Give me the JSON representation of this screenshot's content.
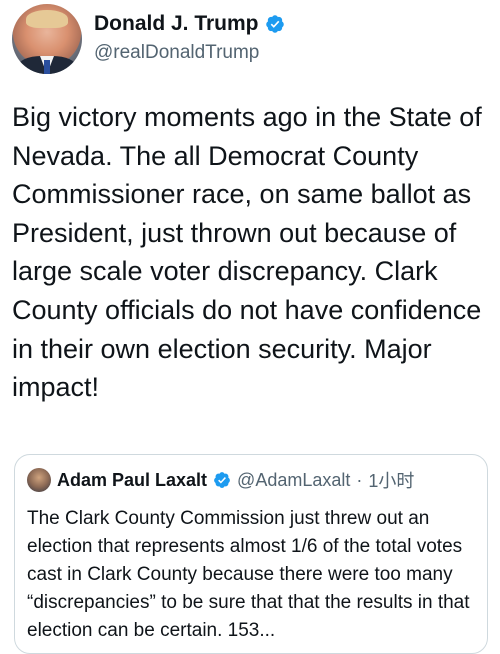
{
  "tweet": {
    "author": {
      "display_name": "Donald J. Trump",
      "handle": "@realDonaldTrump",
      "verified": true
    },
    "text": "Big victory moments ago in the State of Nevada. The all Democrat County Commissioner race, on same ballot as President, just thrown out because of large scale voter discrepancy. Clark County officials do not have confidence in their own election security. Major impact!"
  },
  "quoted_tweet": {
    "author": {
      "display_name": "Adam Paul Laxalt",
      "handle": "@AdamLaxalt",
      "verified": true
    },
    "separator": "·",
    "time": "1小时",
    "text": "The Clark County Commission just threw out an election that represents almost 1/6 of the total votes cast in Clark County because there were too many “discrepancies” to be sure that that the results in that election can be certain. 153..."
  },
  "icons": {
    "verified": "verified-badge-icon"
  },
  "colors": {
    "verified": "#1d9bf0",
    "text": "#0f1419",
    "secondary": "#536471",
    "border": "#cfd9de"
  }
}
